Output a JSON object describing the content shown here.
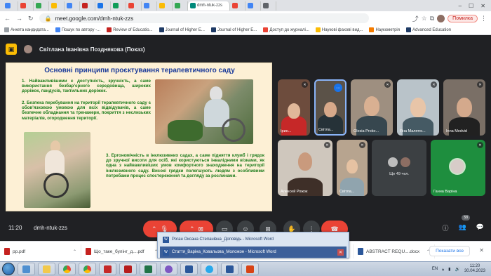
{
  "browser": {
    "address": "meet.google.com/dmh-ntuk-zzs",
    "profile_error": "Помилка",
    "active_tab": "dmh-ntuk-zzs",
    "bookmarks": [
      "Анкета кандидата...",
      "Пошук по автору -...",
      "Review of Educatio...",
      "Journal of Higher E...",
      "Journal of Higher E...",
      "Доступ до журналі...",
      "Наукові фахові вид...",
      "Наукометрія",
      "Advanced Education"
    ]
  },
  "meet": {
    "presenter": "Світлана Іванівна Позднякова (Показ)",
    "time": "11:20",
    "code": "dmh-ntuk-zzs",
    "participants_count": "58",
    "more_label": "Ще 49 чел.",
    "participants": [
      {
        "name": "Ірин..."
      },
      {
        "name": "Світла..."
      },
      {
        "name": "Olesia Proko..."
      },
      {
        "name": "Яна Малятю..."
      },
      {
        "name": "Inna Medvid"
      },
      {
        "name": "Алексей Рожок"
      },
      {
        "name": "Світла..."
      },
      {
        "name": "Ганна Варіна"
      }
    ]
  },
  "slide": {
    "title": "Основні принципи проєктування терапевтичного саду",
    "p1": "1. Найважливішими є доступність, зручність, а саме використання безбар’єрного середовища, широких доріжок, пандусів, тактильних доріжок.",
    "p2": "2. Безпека перебування на території терапевтичного саду є обов’язковою умовою для всіх відвідувачів, а саме безпечне обладнання та тренажери, покриття з неслизьких матеріалів, огородження території.",
    "p3": "3. Ергономічність в інклюзивних садах, а саме підняття клумб і грядок до зручної висоти для осіб, які користуються інвалідними візками, як одна з найважливіших умов комфортного знаходження на території інклюзивного саду. Високі грядки полегшують людям з особливими потребами процес спостереження та догляду за рослинами."
  },
  "taskbar_popup": {
    "windows": [
      "Роган Оксана Степанівна_Доповідь - Microsoft Word",
      "Стаття_Варіна_Ковальова_Моложон - Microsoft Word"
    ]
  },
  "downloads": {
    "items": [
      "pp.pdf",
      "Що_таке_булінг_д....pdf",
      "",
      "",
      "ABSTRACT REQU....docx"
    ],
    "show_all": "Показати все"
  },
  "system": {
    "lang": "EN",
    "time": "11:20",
    "date": "30.04.2023"
  }
}
